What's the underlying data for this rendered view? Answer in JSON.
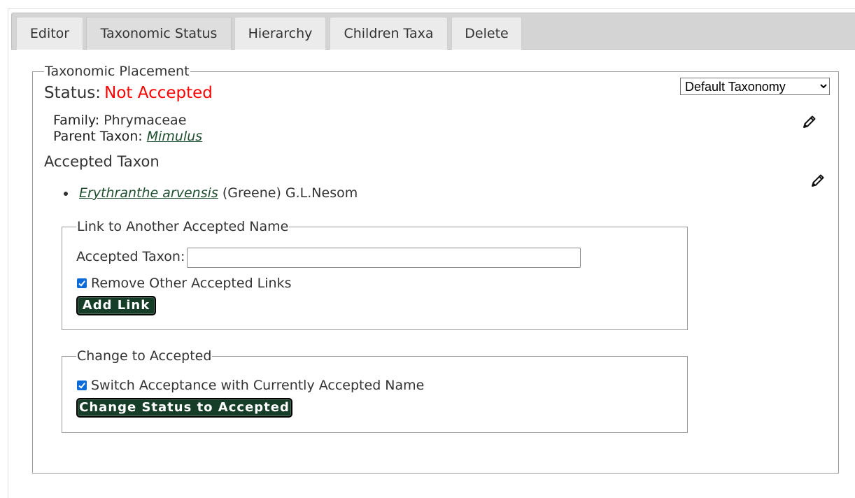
{
  "tabs": [
    {
      "label": "Editor"
    },
    {
      "label": "Taxonomic Status"
    },
    {
      "label": "Hierarchy"
    },
    {
      "label": "Children Taxa"
    },
    {
      "label": "Delete"
    }
  ],
  "placement": {
    "legend": "Taxonomic Placement",
    "status_label": "Status:",
    "status_value": "Not Accepted",
    "taxonomy_select": "Default Taxonomy",
    "family_label": "Family:",
    "family_value": "Phrymaceae",
    "parent_label": "Parent Taxon:",
    "parent_value": "Mimulus"
  },
  "accepted": {
    "heading": "Accepted Taxon",
    "taxon_name": "Erythranthe arvensis",
    "taxon_author": "(Greene) G.L.Nesom"
  },
  "link_section": {
    "legend": "Link to Another Accepted Name",
    "input_label": "Accepted Taxon:",
    "input_value": "",
    "checkbox_label": "Remove Other Accepted Links",
    "checkbox_checked": true,
    "button": "Add Link"
  },
  "change_section": {
    "legend": "Change to Accepted",
    "checkbox_label": "Switch Acceptance with Currently Accepted Name",
    "checkbox_checked": true,
    "button": "Change Status to Accepted"
  },
  "icons": {
    "edit_placement": "pencil-icon",
    "edit_accepted": "pencil-icon",
    "checkbox_mark": "checkmark-icon"
  },
  "colors": {
    "status_not_accepted": "#ff0000",
    "button_bg": "#163d28",
    "link": "#1f4f2f",
    "checkbox": "#0b6bd8"
  }
}
